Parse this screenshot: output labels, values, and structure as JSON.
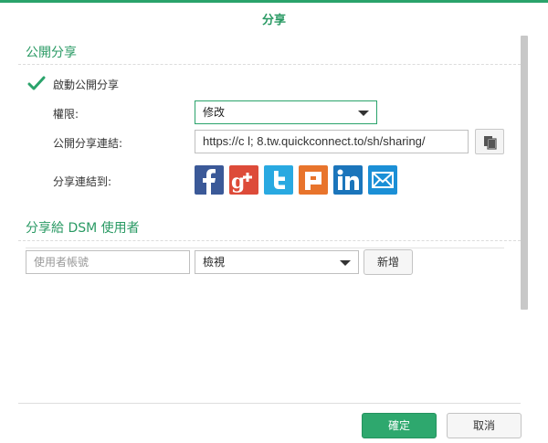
{
  "dialog": {
    "title": "分享"
  },
  "public_share": {
    "section_title": "公開分享",
    "enable_label": "啟動公開分享",
    "enable_checked": true,
    "permission_label": "權限:",
    "permission_value": "修改",
    "link_label": "公開分享連結:",
    "link_value": "https://c      l; 8.tw.quickconnect.to/sh/sharing/",
    "share_to_label": "分享連結到:",
    "social": [
      {
        "name": "facebook",
        "color": "#3b5998"
      },
      {
        "name": "google-plus",
        "color": "#dd4b39"
      },
      {
        "name": "twitter",
        "color": "#29a9e1"
      },
      {
        "name": "plurk",
        "color": "#e8742c"
      },
      {
        "name": "linkedin",
        "color": "#1b75bb"
      },
      {
        "name": "email",
        "color": "#1b8fd6"
      }
    ]
  },
  "dsm_share": {
    "section_title": "分享給 DSM 使用者",
    "user_placeholder": "使用者帳號",
    "permission_value": "檢視",
    "add_label": "新增"
  },
  "footer": {
    "ok_label": "確定",
    "cancel_label": "取消"
  },
  "colors": {
    "accent": "#2aa36b",
    "primary_button": "#2ea86e"
  }
}
